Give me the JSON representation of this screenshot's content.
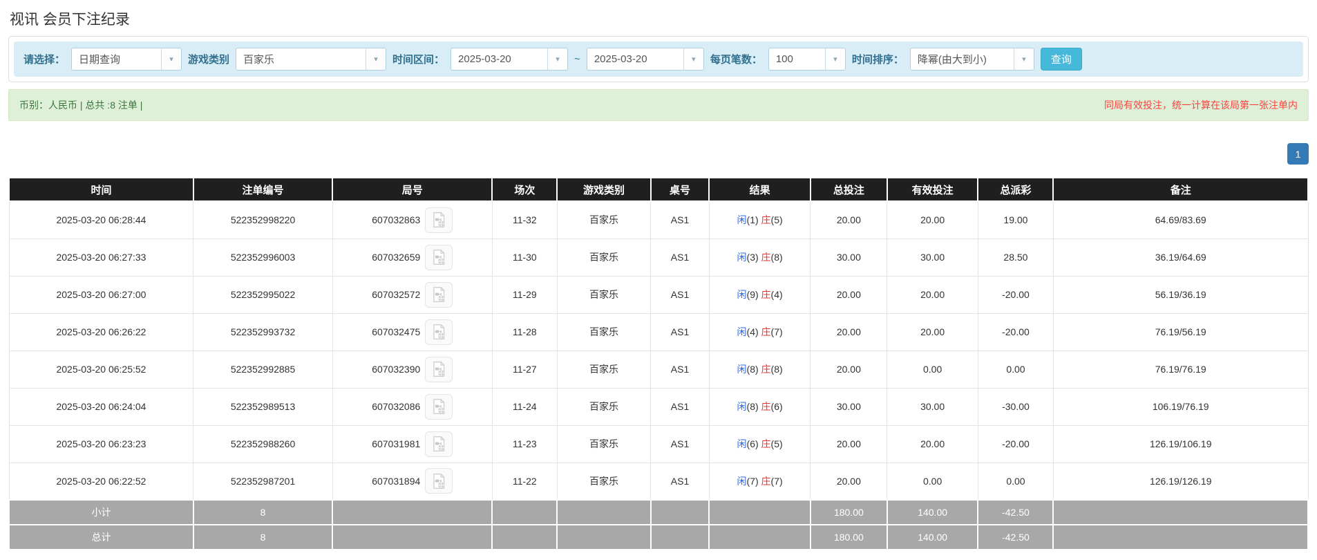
{
  "page_title": "视讯 会员下注纪录",
  "filters": {
    "select_label": "请选择：",
    "select_value": "日期查询",
    "game_type_label": "游戏类别",
    "game_type_value": "百家乐",
    "date_range_label": "时间区间：",
    "date_from": "2025-03-20",
    "date_separator": "~",
    "date_to": "2025-03-20",
    "page_size_label": "每页笔数：",
    "page_size_value": "100",
    "sort_label": "时间排序：",
    "sort_value": "降幂(由大到小)",
    "search_button": "查询"
  },
  "summary_bar": {
    "left_text": "币别：人民币 | 总共 :8 注单 |",
    "right_text": "同局有效投注，统一计算在该局第一张注单内"
  },
  "pagination": {
    "current_page": "1"
  },
  "table": {
    "headers": [
      "时间",
      "注单编号",
      "局号",
      "场次",
      "游戏类别",
      "桌号",
      "结果",
      "总投注",
      "有效投注",
      "总派彩",
      "备注"
    ],
    "rows": [
      {
        "time": "2025-03-20 06:28:44",
        "bet_id": "522352998220",
        "round_id": "607032863",
        "session": "11-32",
        "game": "百家乐",
        "table_no": "AS1",
        "result": {
          "player": "闲",
          "player_score": "(1)",
          "banker": "庄",
          "banker_score": "(5)"
        },
        "total_bet": "20.00",
        "valid_bet": "20.00",
        "total_payout": "19.00",
        "note": "64.69/83.69"
      },
      {
        "time": "2025-03-20 06:27:33",
        "bet_id": "522352996003",
        "round_id": "607032659",
        "session": "11-30",
        "game": "百家乐",
        "table_no": "AS1",
        "result": {
          "player": "闲",
          "player_score": "(3)",
          "banker": "庄",
          "banker_score": "(8)"
        },
        "total_bet": "30.00",
        "valid_bet": "30.00",
        "total_payout": "28.50",
        "note": "36.19/64.69"
      },
      {
        "time": "2025-03-20 06:27:00",
        "bet_id": "522352995022",
        "round_id": "607032572",
        "session": "11-29",
        "game": "百家乐",
        "table_no": "AS1",
        "result": {
          "player": "闲",
          "player_score": "(9)",
          "banker": "庄",
          "banker_score": "(4)"
        },
        "total_bet": "20.00",
        "valid_bet": "20.00",
        "total_payout": "-20.00",
        "note": "56.19/36.19"
      },
      {
        "time": "2025-03-20 06:26:22",
        "bet_id": "522352993732",
        "round_id": "607032475",
        "session": "11-28",
        "game": "百家乐",
        "table_no": "AS1",
        "result": {
          "player": "闲",
          "player_score": "(4)",
          "banker": "庄",
          "banker_score": "(7)"
        },
        "total_bet": "20.00",
        "valid_bet": "20.00",
        "total_payout": "-20.00",
        "note": "76.19/56.19"
      },
      {
        "time": "2025-03-20 06:25:52",
        "bet_id": "522352992885",
        "round_id": "607032390",
        "session": "11-27",
        "game": "百家乐",
        "table_no": "AS1",
        "result": {
          "player": "闲",
          "player_score": "(8)",
          "banker": "庄",
          "banker_score": "(8)"
        },
        "total_bet": "20.00",
        "valid_bet": "0.00",
        "total_payout": "0.00",
        "note": "76.19/76.19"
      },
      {
        "time": "2025-03-20 06:24:04",
        "bet_id": "522352989513",
        "round_id": "607032086",
        "session": "11-24",
        "game": "百家乐",
        "table_no": "AS1",
        "result": {
          "player": "闲",
          "player_score": "(8)",
          "banker": "庄",
          "banker_score": "(6)"
        },
        "total_bet": "30.00",
        "valid_bet": "30.00",
        "total_payout": "-30.00",
        "note": "106.19/76.19"
      },
      {
        "time": "2025-03-20 06:23:23",
        "bet_id": "522352988260",
        "round_id": "607031981",
        "session": "11-23",
        "game": "百家乐",
        "table_no": "AS1",
        "result": {
          "player": "闲",
          "player_score": "(6)",
          "banker": "庄",
          "banker_score": "(5)"
        },
        "total_bet": "20.00",
        "valid_bet": "20.00",
        "total_payout": "-20.00",
        "note": "126.19/106.19"
      },
      {
        "time": "2025-03-20 06:22:52",
        "bet_id": "522352987201",
        "round_id": "607031894",
        "session": "11-22",
        "game": "百家乐",
        "table_no": "AS1",
        "result": {
          "player": "闲",
          "player_score": "(7)",
          "banker": "庄",
          "banker_score": "(7)"
        },
        "total_bet": "20.00",
        "valid_bet": "0.00",
        "total_payout": "0.00",
        "note": "126.19/126.19"
      }
    ],
    "footer_rows": [
      {
        "label": "小计",
        "count": "8",
        "total_bet": "180.00",
        "valid_bet": "140.00",
        "total_payout": "-42.50"
      },
      {
        "label": "总计",
        "count": "8",
        "total_bet": "180.00",
        "valid_bet": "140.00",
        "total_payout": "-42.50"
      }
    ]
  },
  "icons": {
    "dropdown_caret": "▾",
    "round_video_icon": "video-playback-icon"
  },
  "colors": {
    "header_bg": "#1f1f1f",
    "footer_bg": "#a8a8a8",
    "filter_bg": "#d9edf7",
    "filter_label": "#31708f",
    "summary_bg": "#dff0d8",
    "summary_text": "#3c763d",
    "warning_red": "#f9423e",
    "negative_red": "#ff2b2b",
    "link_blue": "#2e7bd6",
    "player_blue": "#3366e0",
    "banker_red": "#e03333",
    "pagination_blue": "#337ab7",
    "search_button": "#46b8da"
  }
}
